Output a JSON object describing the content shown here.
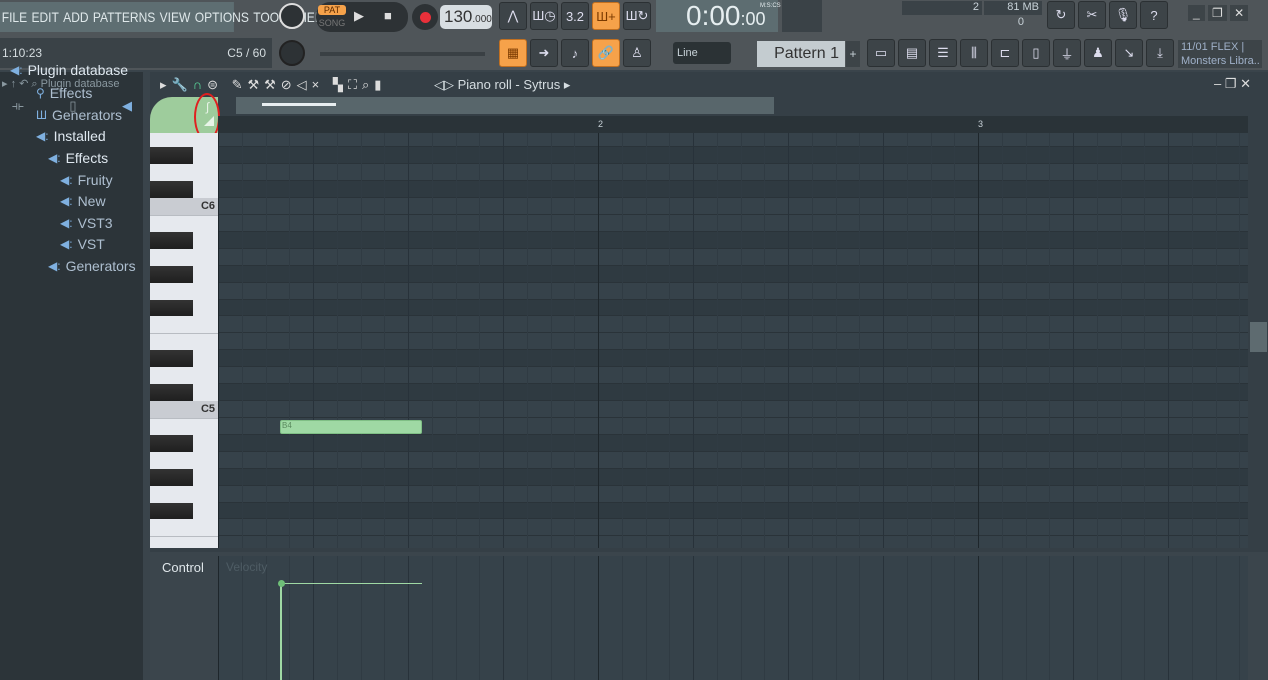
{
  "menu": [
    "FILE",
    "EDIT",
    "ADD",
    "PATTERNS",
    "VIEW",
    "OPTIONS",
    "TOOLS",
    "HELP"
  ],
  "hint": {
    "time": "1:10:23",
    "note": "C5 / 60"
  },
  "transport": {
    "pat": "PAT",
    "song": "SONG",
    "tempo": "130",
    "tempo_frac": ".000"
  },
  "time": {
    "main": "0:00",
    "cs": "00",
    "format": "M:S:CS"
  },
  "monitor": {
    "cpu": "2",
    "mem": "81 MB",
    "poly": "0"
  },
  "snap": "Line",
  "pattern": "Pattern 1",
  "news": {
    "line1": "11/01  FLEX |",
    "line2": "Monsters Libra.."
  },
  "browser": {
    "title": "Plugin database",
    "items": [
      {
        "label": "Plugin database",
        "level": 0
      },
      {
        "label": "Effects",
        "level": 1
      },
      {
        "label": "Generators",
        "level": 1
      },
      {
        "label": "Installed",
        "level": 1
      },
      {
        "label": "Effects",
        "level": 2
      },
      {
        "label": "Fruity",
        "level": 3
      },
      {
        "label": "New",
        "level": 3
      },
      {
        "label": "VST3",
        "level": 3
      },
      {
        "label": "VST",
        "level": 3
      },
      {
        "label": "Generators",
        "level": 2
      }
    ]
  },
  "pianoroll": {
    "title": "Piano roll - Sytrus",
    "bars": [
      "2",
      "3"
    ],
    "keys": {
      "c6": "C6",
      "c5": "C5"
    },
    "note": {
      "label": "B4",
      "start_step": 3,
      "length_steps": 6
    },
    "control_label": "Control",
    "control_target": "Velocity"
  },
  "colors": {
    "accent": "#f6a24a",
    "note": "#9fd9a4",
    "highlight": "#e02020"
  }
}
